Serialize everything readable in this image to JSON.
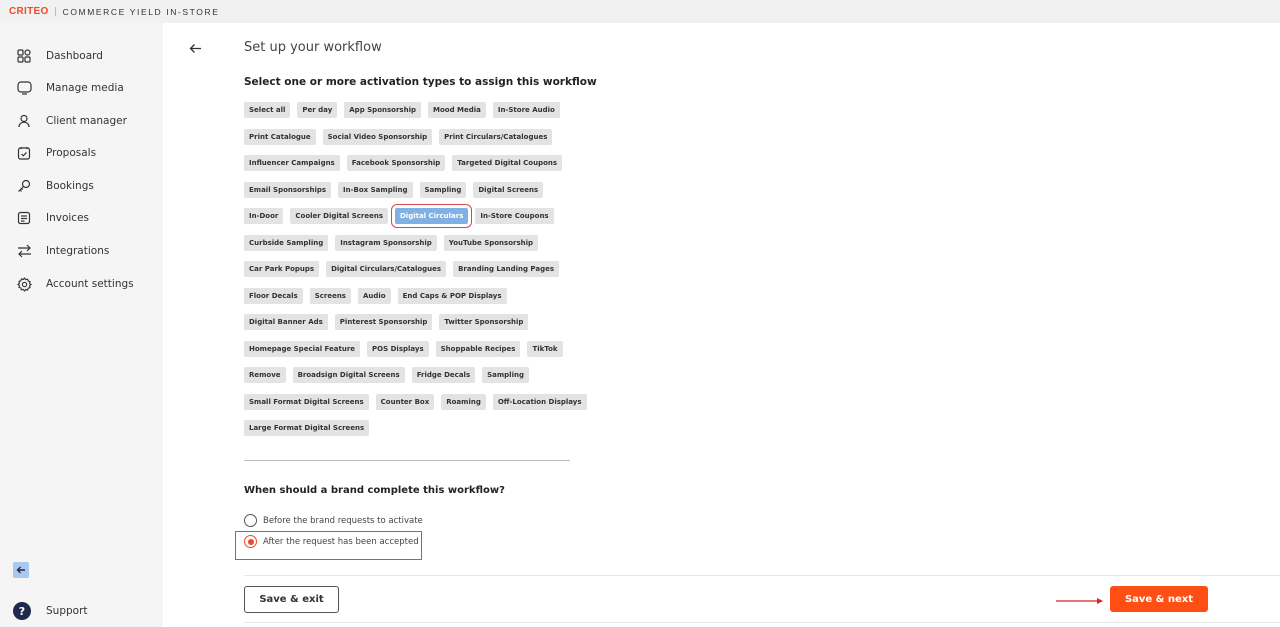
{
  "brand": {
    "logo": "CRITEO",
    "product": "COMMERCE YIELD IN-STORE",
    "accent_color": "#f04a23"
  },
  "sidebar": {
    "items": [
      {
        "label": "Dashboard",
        "icon": "grid-icon"
      },
      {
        "label": "Manage media",
        "icon": "monitor-icon"
      },
      {
        "label": "Client manager",
        "icon": "user-icon"
      },
      {
        "label": "Proposals",
        "icon": "proposals-icon"
      },
      {
        "label": "Bookings",
        "icon": "key-icon"
      },
      {
        "label": "Invoices",
        "icon": "invoice-icon"
      },
      {
        "label": "Integrations",
        "icon": "swap-arrows-icon"
      },
      {
        "label": "Account settings",
        "icon": "gear-icon"
      }
    ],
    "support_label": "Support"
  },
  "main": {
    "title": "Set up your workflow",
    "activation_heading": "Select one or more activation types to assign this workflow",
    "chip_rows": [
      [
        "Select all",
        "Per day",
        "App Sponsorship",
        "Mood Media",
        "In-Store Audio"
      ],
      [
        "Print Catalogue",
        "Social Video Sponsorship",
        "Print Circulars/Catalogues"
      ],
      [
        "Influencer Campaigns",
        "Facebook Sponsorship",
        "Targeted Digital Coupons"
      ],
      [
        "Email Sponsorships",
        "In-Box Sampling",
        "Sampling",
        "Digital Screens"
      ],
      [
        "In-Door",
        "Cooler Digital Screens",
        "Digital Circulars",
        "In-Store Coupons"
      ],
      [
        "Curbside Sampling",
        "Instagram Sponsorship",
        "YouTube Sponsorship"
      ],
      [
        "Car Park Popups",
        "Digital Circulars/Catalogues",
        "Branding Landing Pages"
      ],
      [
        "Floor Decals",
        "Screens",
        "Audio",
        "End Caps & POP Displays"
      ],
      [
        "Digital Banner Ads",
        "Pinterest Sponsorship",
        "Twitter Sponsorship"
      ],
      [
        "Homepage Special Feature",
        "POS Displays",
        "Shoppable Recipes",
        "TikTok"
      ],
      [
        "Remove",
        "Broadsign Digital Screens",
        "Fridge Decals",
        "Sampling"
      ],
      [
        "Small Format Digital Screens",
        "Counter Box",
        "Roaming",
        "Off-Location Displays"
      ],
      [
        "Large Format Digital Screens"
      ]
    ],
    "selected_chip": "Digital Circulars",
    "timing_question": "When should a brand complete this workflow?",
    "timing_options": [
      {
        "label": "Before the brand requests to activate",
        "checked": false
      },
      {
        "label": "After the request has been accepted",
        "checked": true
      }
    ]
  },
  "footer": {
    "save_exit_label": "Save & exit",
    "save_next_label": "Save & next"
  }
}
